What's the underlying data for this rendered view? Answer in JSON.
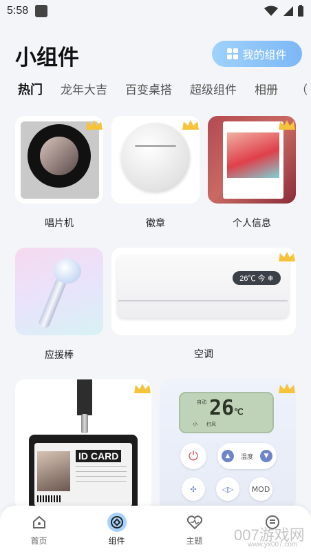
{
  "status_bar": {
    "time": "5:58"
  },
  "header": {
    "title": "小组件",
    "my_widgets_label": "我的组件"
  },
  "tabs": [
    {
      "label": "热门",
      "active": true
    },
    {
      "label": "龙年大吉",
      "active": false
    },
    {
      "label": "百变桌搭",
      "active": false
    },
    {
      "label": "超级组件",
      "active": false
    },
    {
      "label": "相册",
      "active": false
    },
    {
      "label": "（",
      "active": false
    }
  ],
  "widgets": [
    {
      "label": "唱片机",
      "premium": true
    },
    {
      "label": "徽章",
      "premium": true
    },
    {
      "label": "个人信息",
      "premium": true
    },
    {
      "label": "应援棒",
      "premium": false
    },
    {
      "label": "空调",
      "premium": true,
      "display_text": "26℃ 今 ❄"
    },
    {
      "label": "",
      "premium": true,
      "card_title": "ID CARD"
    },
    {
      "label": "",
      "premium": true,
      "lcd_temp": "26",
      "lcd_unit": "℃",
      "lcd_mode": "自动",
      "lcd_small_1": "小",
      "lcd_small_2": "扫风",
      "mode_label": "温度",
      "mod_label": "MOD"
    }
  ],
  "bottom_nav": [
    {
      "label": "首页",
      "icon": "home-icon",
      "active": false
    },
    {
      "label": "组件",
      "icon": "widget-icon",
      "active": true
    },
    {
      "label": "主题",
      "icon": "theme-icon",
      "active": false
    },
    {
      "label": "",
      "icon": "profile-icon",
      "active": false
    }
  ],
  "watermark": {
    "brand": "007游戏网",
    "url": "www.yx007.com"
  },
  "colors": {
    "accent": "#7db7f6",
    "crown": "#f6c43a"
  }
}
